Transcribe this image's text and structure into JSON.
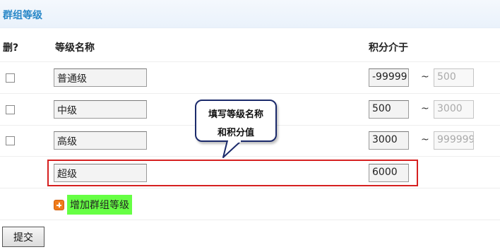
{
  "page_title": "群组等级",
  "headers": {
    "delete": "删?",
    "name": "等级名称",
    "points": "积分介于"
  },
  "range_separator": "~",
  "rows": [
    {
      "name": "普通级",
      "min": "-99999",
      "max": "500",
      "checked": false
    },
    {
      "name": "中级",
      "min": "500",
      "max": "3000",
      "checked": false
    },
    {
      "name": "高级",
      "min": "3000",
      "max": "999999",
      "checked": false
    }
  ],
  "new_row": {
    "name": "超级",
    "min": "6000"
  },
  "callout": {
    "line1": "填写等级名称",
    "line2": "和积分值"
  },
  "add_link": {
    "label": "增加群组等级",
    "icon": "plus-icon"
  },
  "submit": {
    "label": "提交"
  },
  "colors": {
    "title": "#2a88c8",
    "highlight_border": "#d62020",
    "callout_border": "#1b2a6b",
    "add_highlight": "#66ff44",
    "add_icon": "#f07c1a"
  }
}
